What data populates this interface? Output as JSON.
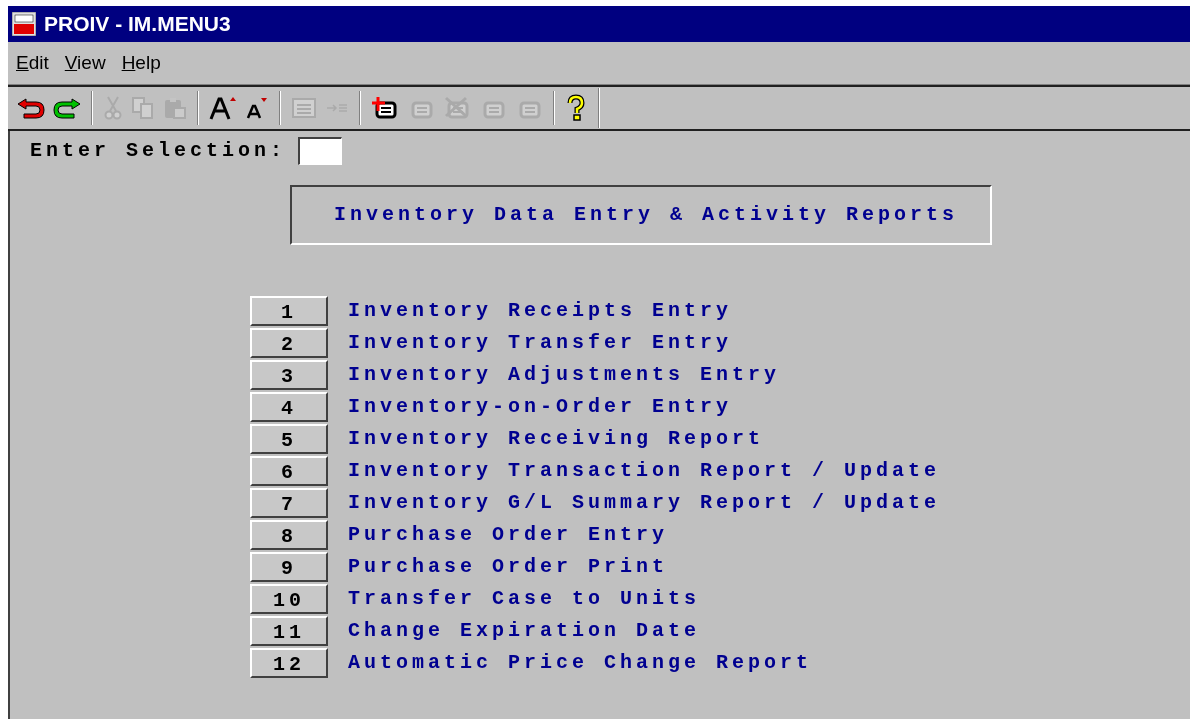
{
  "window": {
    "title": "PROIV - IM.MENU3"
  },
  "menu": [
    {
      "label": "Edit"
    },
    {
      "label": "View"
    },
    {
      "label": "Help"
    }
  ],
  "toolbar": [
    {
      "kind": "undo",
      "disabled": false
    },
    {
      "kind": "redo",
      "disabled": false
    },
    {
      "kind": "sep"
    },
    {
      "kind": "cut",
      "disabled": true
    },
    {
      "kind": "copy",
      "disabled": true
    },
    {
      "kind": "paste",
      "disabled": true
    },
    {
      "kind": "sep"
    },
    {
      "kind": "font-up",
      "disabled": false
    },
    {
      "kind": "font-down",
      "disabled": false
    },
    {
      "kind": "sep"
    },
    {
      "kind": "list",
      "disabled": true
    },
    {
      "kind": "tab",
      "disabled": true
    },
    {
      "kind": "sep"
    },
    {
      "kind": "record-add",
      "disabled": false
    },
    {
      "kind": "record",
      "disabled": true
    },
    {
      "kind": "record-delete",
      "disabled": true
    },
    {
      "kind": "record",
      "disabled": true
    },
    {
      "kind": "record",
      "disabled": true
    },
    {
      "kind": "sep"
    },
    {
      "kind": "help",
      "disabled": false
    }
  ],
  "selection": {
    "label": "Enter Selection:"
  },
  "heading": "Inventory Data Entry & Activity Reports",
  "options": [
    {
      "number": "1",
      "label": "Inventory Receipts Entry"
    },
    {
      "number": "2",
      "label": "Inventory Transfer Entry"
    },
    {
      "number": "3",
      "label": "Inventory Adjustments Entry"
    },
    {
      "number": "4",
      "label": "Inventory-on-Order Entry"
    },
    {
      "number": "5",
      "label": "Inventory Receiving Report"
    },
    {
      "number": "6",
      "label": "Inventory Transaction Report / Update"
    },
    {
      "number": "7",
      "label": "Inventory G/L Summary Report / Update"
    },
    {
      "number": "8",
      "label": "Purchase Order Entry"
    },
    {
      "number": "9",
      "label": "Purchase Order Print"
    },
    {
      "number": "10",
      "label": "Transfer Case to Units"
    },
    {
      "number": "11",
      "label": "Change Expiration Date"
    },
    {
      "number": "12",
      "label": "Automatic Price Change Report"
    }
  ]
}
